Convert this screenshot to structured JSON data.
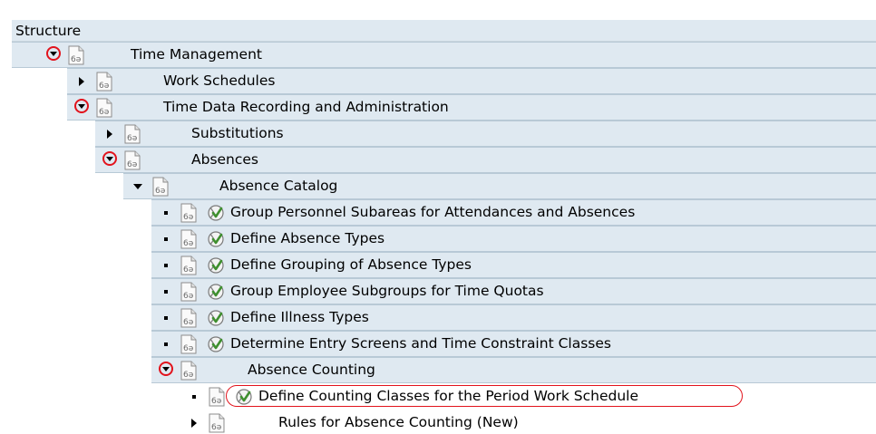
{
  "header": {
    "title": "Structure"
  },
  "tree": [
    {
      "label": "Time Management",
      "toggle": "expanded-circled",
      "level": 0,
      "exec": false,
      "shaded": true
    },
    {
      "label": "Work Schedules",
      "toggle": "collapsed",
      "level": 1,
      "exec": false,
      "shaded": true
    },
    {
      "label": "Time Data Recording and Administration",
      "toggle": "expanded-circled",
      "level": 1,
      "exec": false,
      "shaded": true
    },
    {
      "label": "Substitutions",
      "toggle": "collapsed",
      "level": 2,
      "exec": false,
      "shaded": true
    },
    {
      "label": "Absences",
      "toggle": "expanded-circled",
      "level": 2,
      "exec": false,
      "shaded": true
    },
    {
      "label": "Absence Catalog",
      "toggle": "expanded",
      "level": 3,
      "exec": false,
      "shaded": true
    },
    {
      "label": "Group Personnel Subareas for Attendances and Absences",
      "toggle": "leaf",
      "level": 4,
      "exec": true,
      "shaded": true
    },
    {
      "label": "Define Absence Types",
      "toggle": "leaf",
      "level": 4,
      "exec": true,
      "shaded": true
    },
    {
      "label": "Define Grouping of Absence Types",
      "toggle": "leaf",
      "level": 4,
      "exec": true,
      "shaded": true
    },
    {
      "label": "Group Employee Subgroups for Time Quotas",
      "toggle": "leaf",
      "level": 4,
      "exec": true,
      "shaded": true
    },
    {
      "label": "Define Illness Types",
      "toggle": "leaf",
      "level": 4,
      "exec": true,
      "shaded": true
    },
    {
      "label": "Determine Entry Screens and Time Constraint Classes",
      "toggle": "leaf",
      "level": 4,
      "exec": true,
      "shaded": true
    },
    {
      "label": "Absence Counting",
      "toggle": "expanded-circled",
      "level": 4,
      "exec": false,
      "shaded": true
    },
    {
      "label": "Define Counting Classes for the Period Work Schedule",
      "toggle": "leaf",
      "level": 5,
      "exec": true,
      "shaded": false,
      "highlighted": true
    },
    {
      "label": "Rules for Absence Counting (New)",
      "toggle": "collapsed",
      "level": 5,
      "exec": false,
      "shaded": false
    }
  ],
  "icons": {
    "node": "structure-node-icon",
    "execute": "execute-activity-icon",
    "toggle_expanded": "expand-down-icon",
    "toggle_collapsed": "expand-right-icon",
    "leaf": "leaf-bullet-icon"
  },
  "colors": {
    "row_shading": "#dfe9f1",
    "row_border": "#b8c9d6",
    "annotation_red": "#e2131c",
    "execute_green": "#3f8f2f"
  }
}
